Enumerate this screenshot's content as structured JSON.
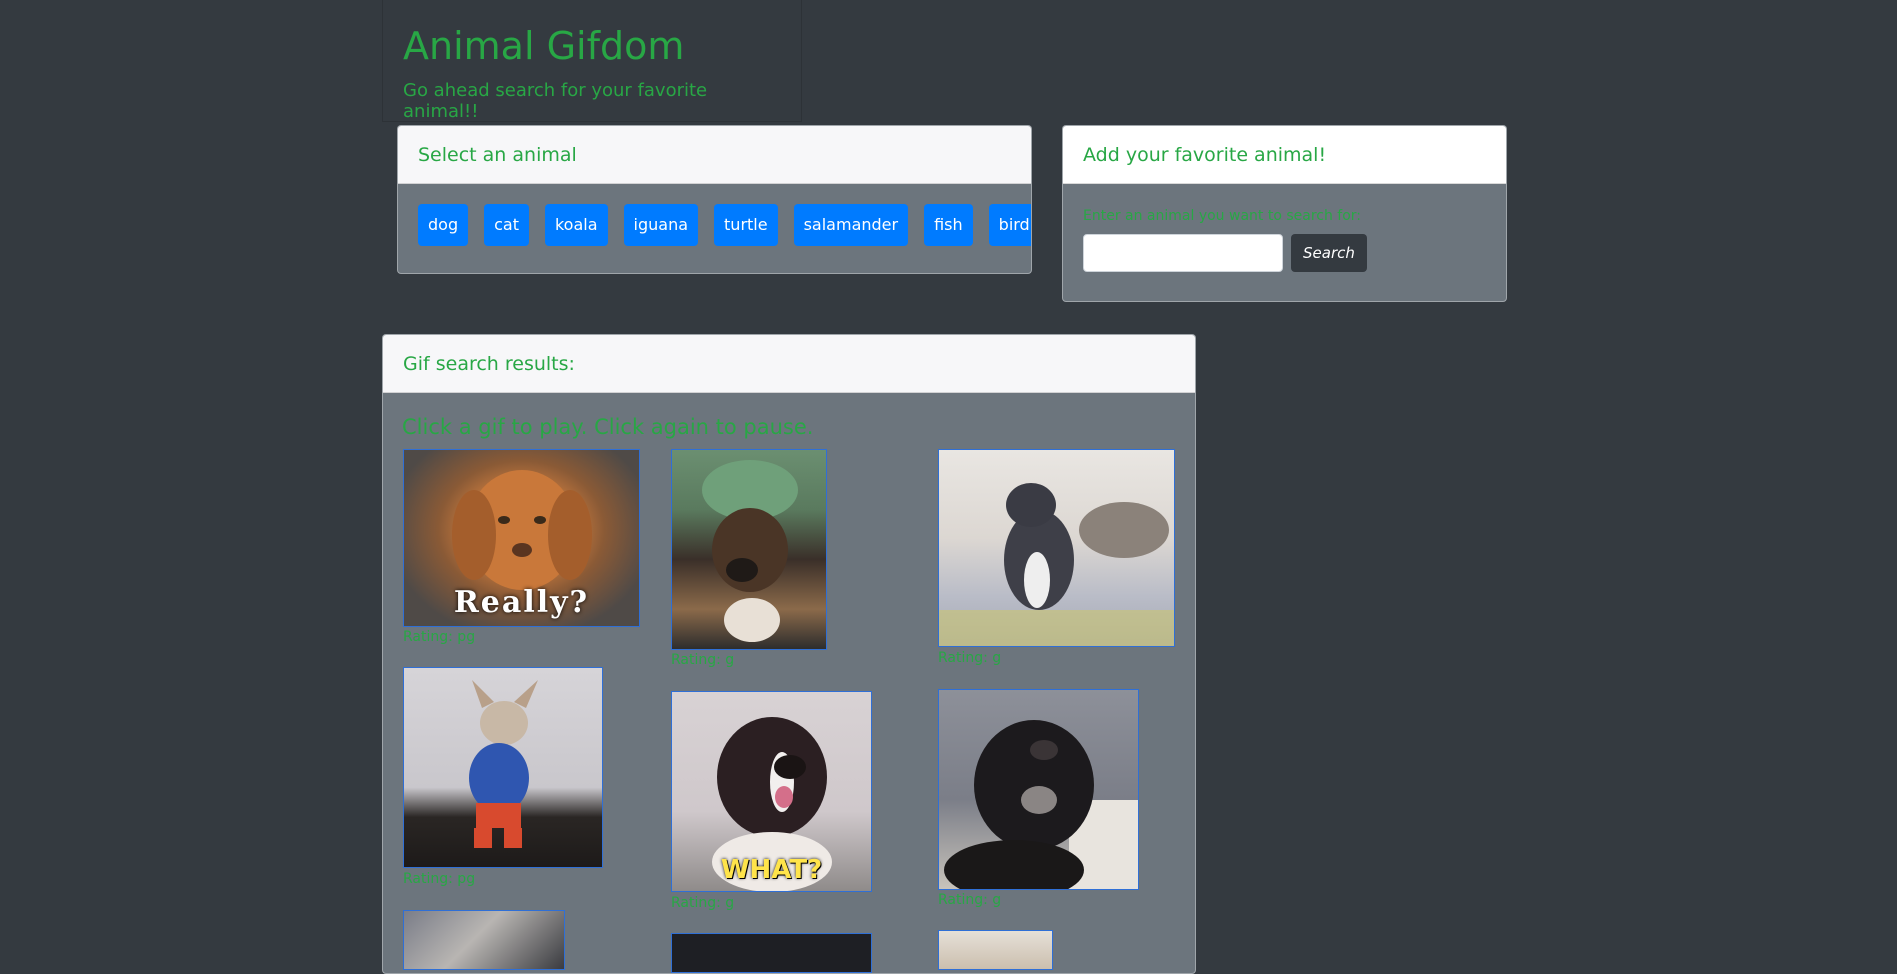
{
  "header": {
    "title": "Animal Gifdom",
    "subtitle": "Go ahead search for your favorite animal!!"
  },
  "animal_select": {
    "title": "Select an animal",
    "buttons": [
      "dog",
      "cat",
      "koala",
      "iguana",
      "turtle",
      "salamander",
      "fish",
      "bird"
    ]
  },
  "add_animal": {
    "title": "Add your favorite animal!",
    "label": "Enter an animal you want to search for:",
    "input_value": "",
    "search_label": "Search"
  },
  "results": {
    "title": "Gif search results:",
    "instruction": "Click a gif to play. Click again to pause.",
    "gifs": [
      {
        "rating": "Rating: pg",
        "caption": "Really?"
      },
      {
        "rating": "Rating: g",
        "caption": ""
      },
      {
        "rating": "Rating: g",
        "caption": ""
      },
      {
        "rating": "Rating: pg",
        "caption": ""
      },
      {
        "rating": "Rating: g",
        "caption": "WHAT?"
      },
      {
        "rating": "Rating: g",
        "caption": ""
      }
    ]
  },
  "colors": {
    "background": "#343a40",
    "accent_green": "#28a745",
    "button_blue": "#007bff"
  }
}
